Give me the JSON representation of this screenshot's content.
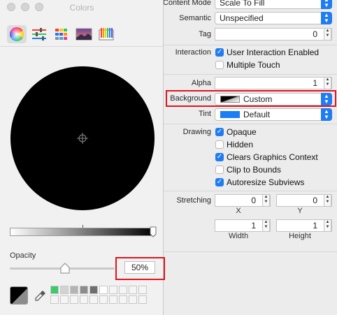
{
  "inspector": {
    "content_mode": {
      "label": "Content Mode",
      "value": "Scale To Fill"
    },
    "semantic": {
      "label": "Semantic",
      "value": "Unspecified"
    },
    "tag": {
      "label": "Tag",
      "value": "0"
    },
    "interaction": {
      "label": "Interaction",
      "user_interaction": {
        "label": "User Interaction Enabled",
        "checked": true
      },
      "multiple_touch": {
        "label": "Multiple Touch",
        "checked": false
      }
    },
    "alpha": {
      "label": "Alpha",
      "value": "1"
    },
    "background": {
      "label": "Background",
      "value": "Custom"
    },
    "tint": {
      "label": "Tint",
      "value": "Default",
      "swatch_color": "#1a7ef4"
    },
    "drawing": {
      "label": "Drawing",
      "opaque": {
        "label": "Opaque",
        "checked": true
      },
      "hidden": {
        "label": "Hidden",
        "checked": false
      },
      "clears": {
        "label": "Clears Graphics Context",
        "checked": true
      },
      "clip": {
        "label": "Clip to Bounds",
        "checked": false
      },
      "autoresize": {
        "label": "Autoresize Subviews",
        "checked": true
      }
    },
    "stretching": {
      "label": "Stretching",
      "x": {
        "value": "0",
        "label": "X"
      },
      "y": {
        "value": "0",
        "label": "Y"
      },
      "width": {
        "value": "1",
        "label": "Width"
      },
      "height": {
        "value": "1",
        "label": "Height"
      }
    }
  },
  "colors_panel": {
    "title": "Colors",
    "tabs": [
      {
        "icon": "color-wheel-icon",
        "selected": true
      },
      {
        "icon": "color-sliders-icon",
        "selected": false
      },
      {
        "icon": "color-palettes-icon",
        "selected": false
      },
      {
        "icon": "image-palettes-icon",
        "selected": false
      },
      {
        "icon": "pencils-icon",
        "selected": false
      }
    ],
    "opacity_label": "Opacity",
    "opacity_value": "50%",
    "opacity_fraction": 0.5,
    "current_color": "#000000",
    "favorites": [
      "#3ec96d",
      "#d2d2d2",
      "#b4b4b4",
      "#8c8c8c",
      "#6e6e6e",
      "#ffffff"
    ]
  },
  "accent_color": "#1f7cf2",
  "highlight_color": "#e0141e"
}
